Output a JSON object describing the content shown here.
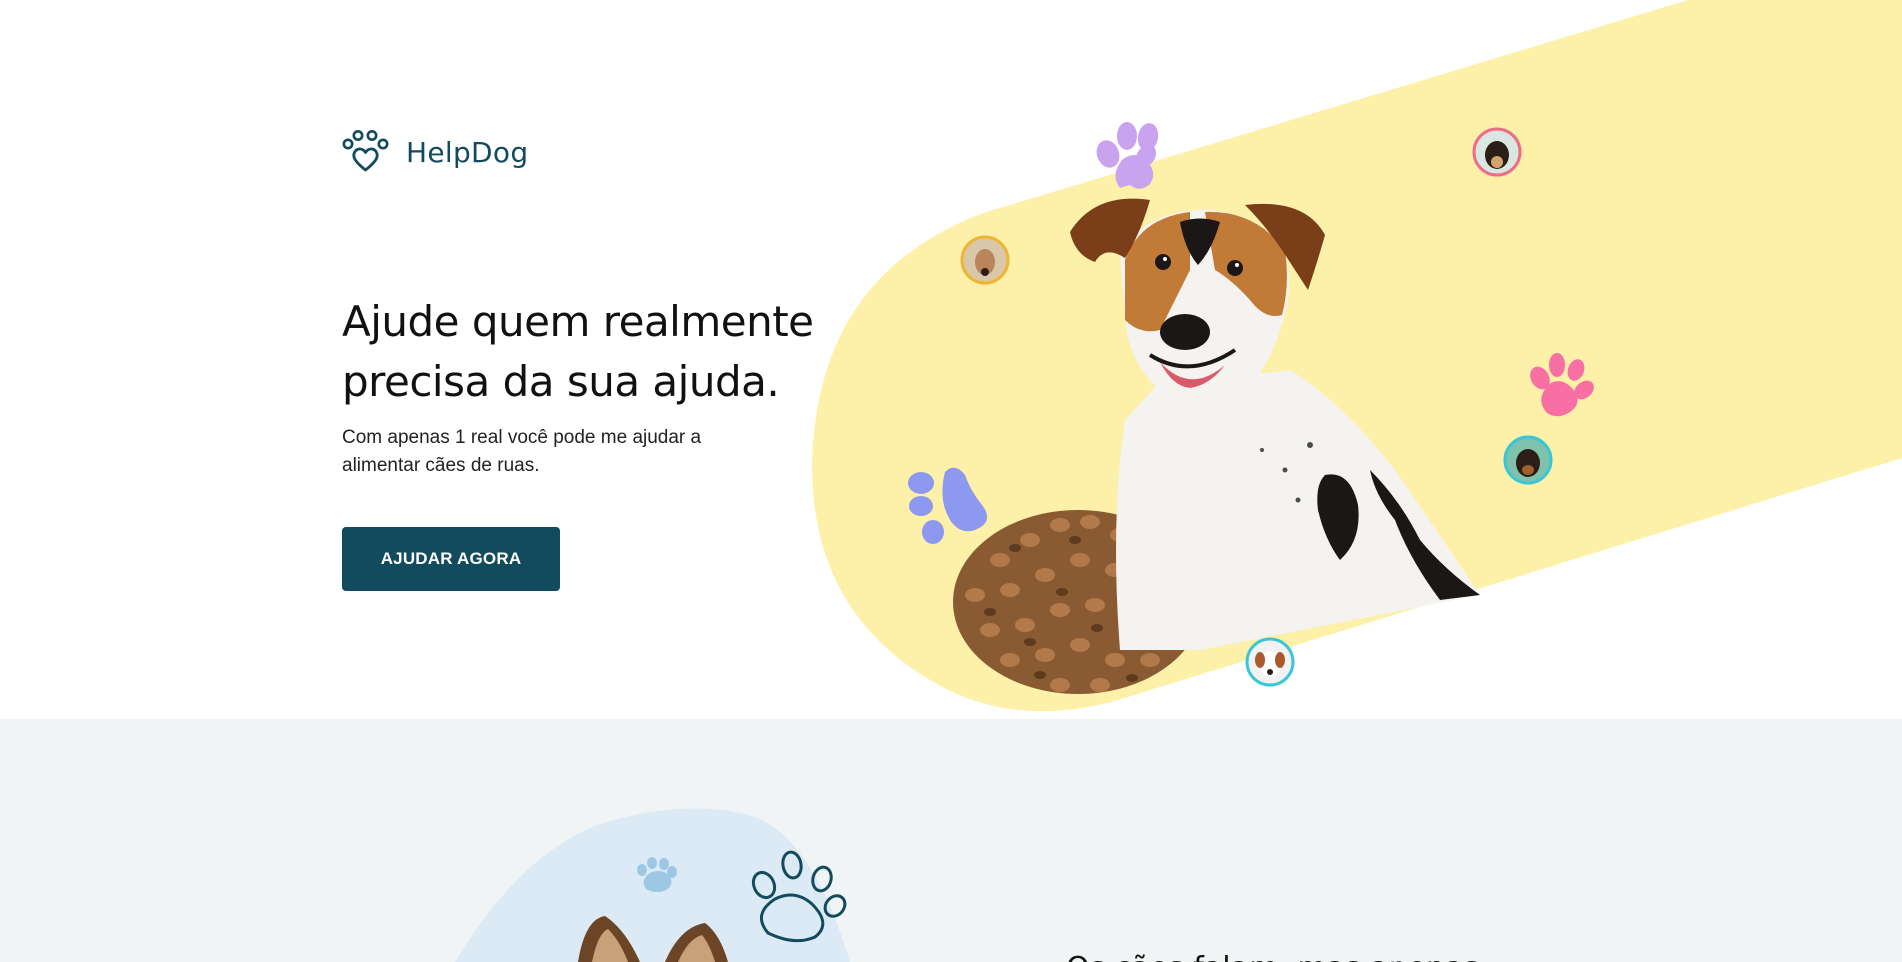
{
  "brand": {
    "name": "HelpDog",
    "icon": "paw-heart-icon",
    "color": "#124a5e"
  },
  "hero": {
    "title": "Ajude quem realmente precisa da sua ajuda.",
    "subtitle": "Com apenas 1 real você pode me ajudar a alimentar cães de ruas.",
    "cta_label": "AJUDAR AGORA",
    "accent_color": "#fdf0a8",
    "paw_colors": [
      "#c9a3f0",
      "#f76fa3",
      "#8d98f0"
    ]
  },
  "section2": {
    "heading": "Os cães falam, mas apenas",
    "background": "#f1f4f5"
  }
}
